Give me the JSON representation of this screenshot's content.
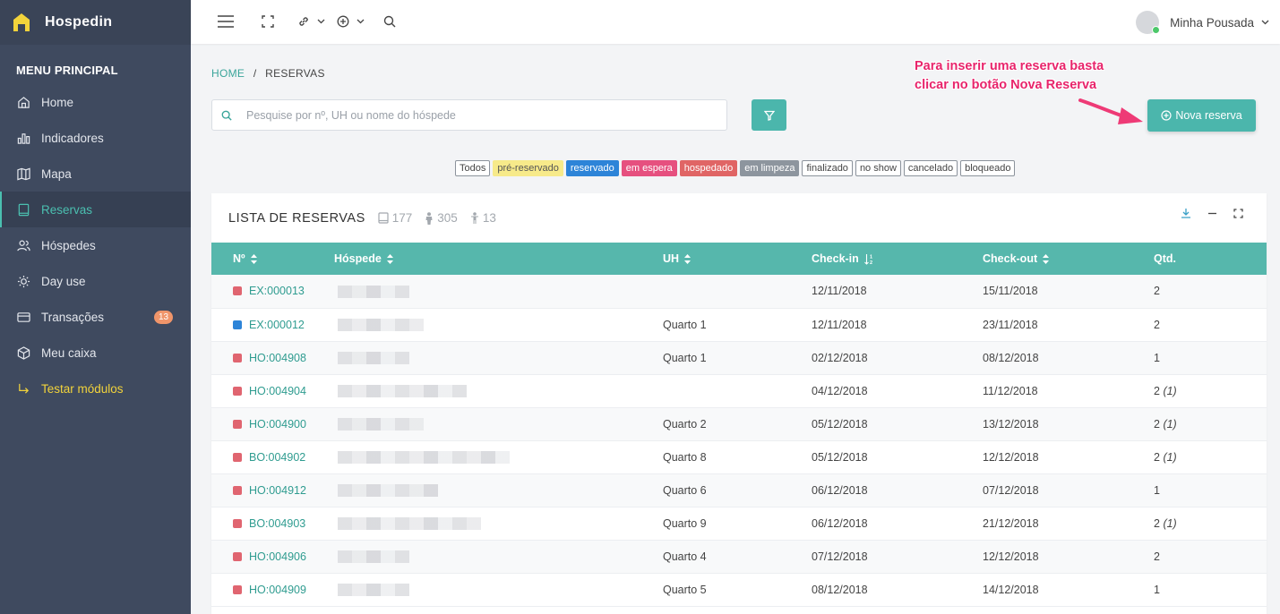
{
  "brand": {
    "name": "Hospedin"
  },
  "sidebar": {
    "title": "MENU PRINCIPAL",
    "items": [
      {
        "label": "Home",
        "icon": "home-icon"
      },
      {
        "label": "Indicadores",
        "icon": "bar-chart-icon"
      },
      {
        "label": "Mapa",
        "icon": "map-icon"
      },
      {
        "label": "Reservas",
        "icon": "book-icon",
        "active": true
      },
      {
        "label": "Hóspedes",
        "icon": "users-icon"
      },
      {
        "label": "Day use",
        "icon": "sun-icon"
      },
      {
        "label": "Transações",
        "icon": "credit-card-icon",
        "badge": "13"
      },
      {
        "label": "Meu caixa",
        "icon": "box-icon"
      },
      {
        "label": "Testar módulos",
        "icon": "corner-arrow-icon"
      }
    ]
  },
  "topbar": {
    "user_name": "Minha Pousada"
  },
  "breadcrumb": {
    "home": "HOME",
    "separator": "/",
    "current": "RESERVAS"
  },
  "search": {
    "placeholder": "Pesquise por nº, UH ou nome do hóspede",
    "value": ""
  },
  "annotation": {
    "line1": "Para inserir uma reserva basta",
    "line2": "clicar no botão Nova Reserva"
  },
  "new_reservation_label": "Nova reserva",
  "status_filters": [
    "Todos",
    "pré-reservado",
    "reservado",
    "em espera",
    "hospedado",
    "em limpeza",
    "finalizado",
    "no show",
    "cancelado",
    "bloqueado"
  ],
  "list": {
    "title": "LISTA DE RESERVAS",
    "stats": {
      "reservations": "177",
      "adults": "305",
      "children": "13"
    },
    "columns": [
      "Nº",
      "Hóspede",
      "UH",
      "Check-in",
      "Check-out",
      "Qtd."
    ],
    "rows": [
      {
        "num": "EX:000013",
        "status_color": "#e06570",
        "uh": "",
        "checkin": "12/11/2018",
        "checkout": "15/11/2018",
        "qty": "2",
        "qty_extra": ""
      },
      {
        "num": "EX:000012",
        "status_color": "#2d84d8",
        "uh": "Quarto 1",
        "checkin": "12/11/2018",
        "checkout": "23/11/2018",
        "qty": "2",
        "qty_extra": ""
      },
      {
        "num": "HO:004908",
        "status_color": "#e06570",
        "uh": "Quarto 1",
        "checkin": "02/12/2018",
        "checkout": "08/12/2018",
        "qty": "1",
        "qty_extra": ""
      },
      {
        "num": "HO:004904",
        "status_color": "#e06570",
        "uh": "",
        "checkin": "04/12/2018",
        "checkout": "11/12/2018",
        "qty": "2",
        "qty_extra": "(1)"
      },
      {
        "num": "HO:004900",
        "status_color": "#e06570",
        "uh": "Quarto 2",
        "checkin": "05/12/2018",
        "checkout": "13/12/2018",
        "qty": "2",
        "qty_extra": "(1)"
      },
      {
        "num": "BO:004902",
        "status_color": "#e06570",
        "uh": "Quarto 8",
        "checkin": "05/12/2018",
        "checkout": "12/12/2018",
        "qty": "2",
        "qty_extra": "(1)"
      },
      {
        "num": "HO:004912",
        "status_color": "#e06570",
        "uh": "Quarto 6",
        "checkin": "06/12/2018",
        "checkout": "07/12/2018",
        "qty": "1",
        "qty_extra": ""
      },
      {
        "num": "BO:004903",
        "status_color": "#e06570",
        "uh": "Quarto 9",
        "checkin": "06/12/2018",
        "checkout": "21/12/2018",
        "qty": "2",
        "qty_extra": "(1)"
      },
      {
        "num": "HO:004906",
        "status_color": "#e06570",
        "uh": "Quarto 4",
        "checkin": "07/12/2018",
        "checkout": "12/12/2018",
        "qty": "2",
        "qty_extra": ""
      },
      {
        "num": "HO:004909",
        "status_color": "#e06570",
        "uh": "Quarto 5",
        "checkin": "08/12/2018",
        "checkout": "14/12/2018",
        "qty": "1",
        "qty_extra": ""
      }
    ]
  },
  "colors": {
    "accent": "#4bb6ac",
    "sidebar_bg": "#3f4a5f",
    "annotation": "#e8246b",
    "active_menu": "#4bbfb0",
    "highlight_menu": "#f2d33b"
  }
}
